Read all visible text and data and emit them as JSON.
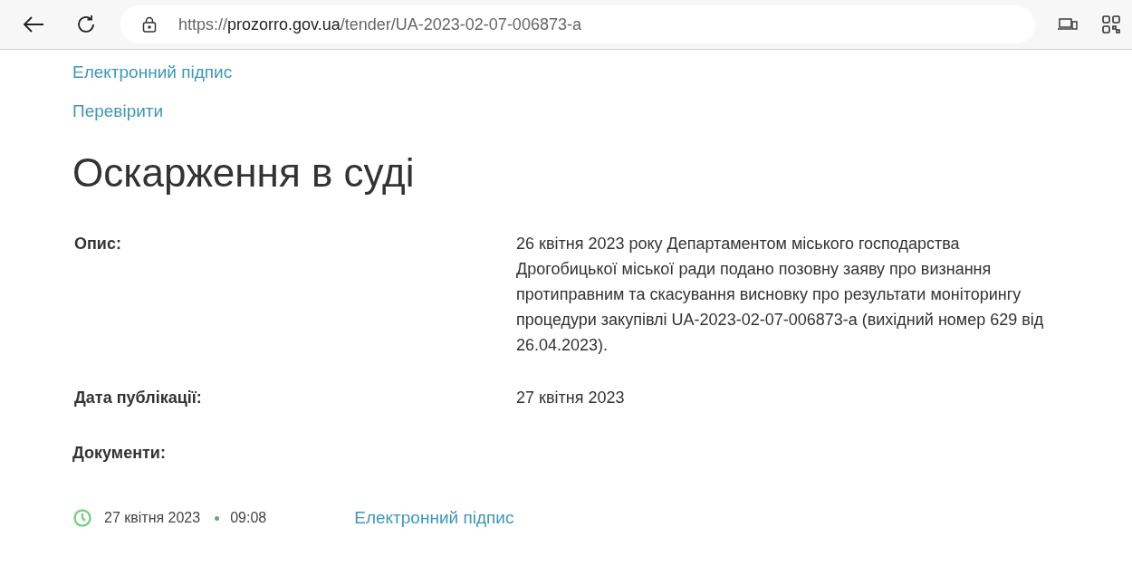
{
  "browser": {
    "url_scheme": "https://",
    "url_host": "prozorro.gov.ua",
    "url_path": "/tender/UA-2023-02-07-006873-a"
  },
  "top_links": [
    "Електронний підпис",
    "Перевірити"
  ],
  "heading": "Оскарження в суді",
  "fields": [
    {
      "label": "Опис:",
      "value": "26 квітня 2023 року Департаментом міського господарства Дрогобицької міської ради подано позовну заяву про визнання протиправним та скасування висновку про результати моніторингу процедури закупівлі UA-2023-02-07-006873-а (вихідний номер 629 від 26.04.2023)."
    },
    {
      "label": "Дата публікації:",
      "value": "27 квітня 2023"
    }
  ],
  "documents": {
    "label": "Документи:",
    "items": [
      {
        "date": "27 квітня 2023",
        "time": "09:08",
        "link": "Електронний підпис"
      }
    ]
  }
}
